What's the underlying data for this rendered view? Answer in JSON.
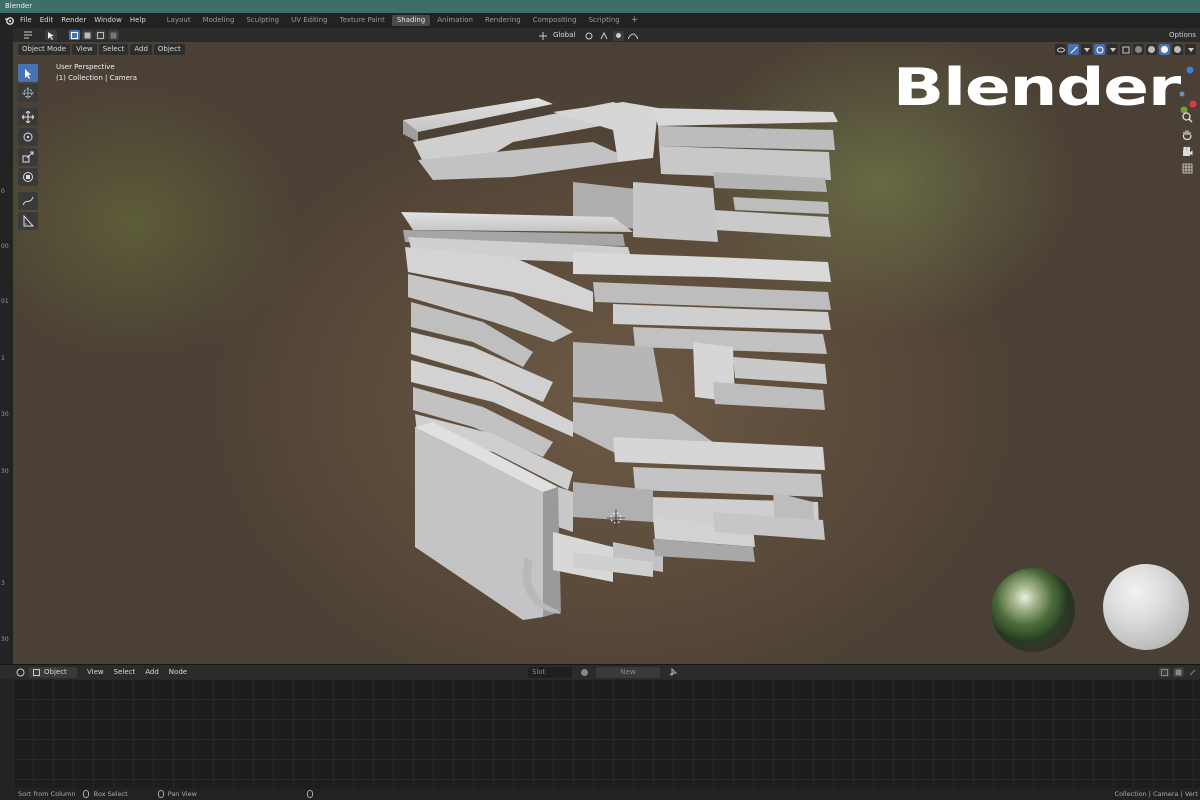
{
  "window": {
    "title": "Blender"
  },
  "menubar": {
    "menus": [
      "File",
      "Edit",
      "Render",
      "Window",
      "Help"
    ],
    "workspaces": [
      "Layout",
      "Modeling",
      "Sculpting",
      "UV Editing",
      "Texture Paint",
      "Shading",
      "Animation",
      "Rendering",
      "Compositing",
      "Scripting"
    ],
    "active_workspace": "Shading",
    "add_tab": "+"
  },
  "tool_header": {
    "transform_orientation": "Global",
    "options_label": "Options"
  },
  "viewport": {
    "mode": "Object Mode",
    "menus": [
      "View",
      "Select",
      "Add",
      "Object"
    ],
    "info_line1": "User Perspective",
    "info_line2": "(1) Collection | Camera",
    "brand_text": "Blender",
    "gutter_numbers": [
      "0",
      "00",
      "01",
      "1",
      "30",
      "30",
      "3",
      "30"
    ]
  },
  "node_editor": {
    "type": "Object",
    "menus": [
      "View",
      "Select",
      "Add",
      "Node"
    ],
    "slot": "Slot",
    "new_button": "New"
  },
  "status_bar": {
    "hint1": "Sort from Column",
    "hint2": "Box Select",
    "hint3": "Pan View",
    "right_text": "Collection | Camera | Vert"
  },
  "colors": {
    "accent": "#4772b3",
    "title_bar": "#3d6e6a",
    "model_gray": "#c9c9c9"
  }
}
